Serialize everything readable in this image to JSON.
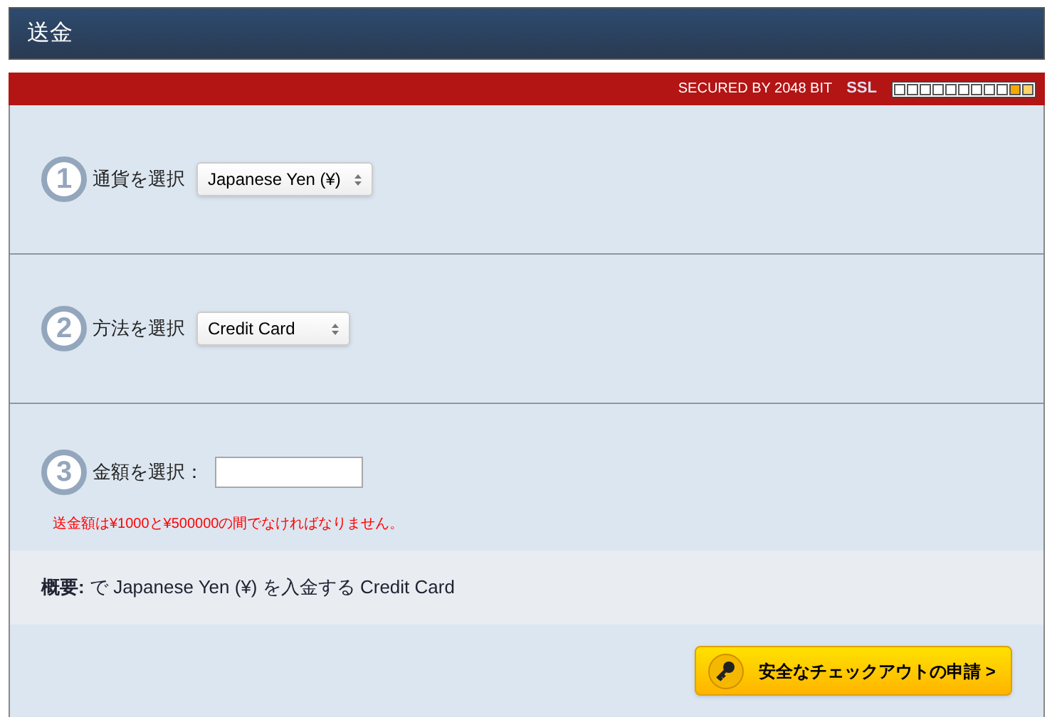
{
  "header": {
    "title": "送金"
  },
  "security_bar": {
    "text": "SECURED BY 2048 BIT",
    "ssl_label": "SSL",
    "level": 0.18
  },
  "steps": [
    {
      "number": "1",
      "label": "通貨を選択",
      "kind": "select",
      "value": "Japanese Yen (¥)"
    },
    {
      "number": "2",
      "label": "方法を選択",
      "kind": "select",
      "value": "Credit Card"
    },
    {
      "number": "3",
      "label": "金額を選択：",
      "kind": "input",
      "error": "送金額は¥1000と¥500000の間でなければなりません。"
    }
  ],
  "summary": {
    "text": "**概要:** で Japanese Yen (¥) を入金する Credit Card"
  },
  "checkout_button": {
    "label": "安全なチェックアウトの申請 >"
  }
}
